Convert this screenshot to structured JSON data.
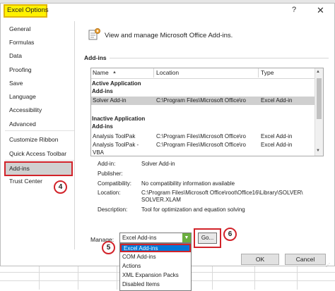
{
  "window": {
    "title": "Excel Options",
    "help_glyph": "?",
    "close_glyph": "✕"
  },
  "sidebar": {
    "items": [
      {
        "label": "General"
      },
      {
        "label": "Formulas"
      },
      {
        "label": "Data"
      },
      {
        "label": "Proofing"
      },
      {
        "label": "Save"
      },
      {
        "label": "Language"
      },
      {
        "label": "Accessibility"
      },
      {
        "label": "Advanced"
      },
      {
        "label": "Customize Ribbon"
      },
      {
        "label": "Quick Access Toolbar"
      },
      {
        "label": "Add-ins",
        "selected": true
      },
      {
        "label": "Trust Center"
      }
    ],
    "step_badge": "4"
  },
  "main": {
    "header_text": "View and manage Microsoft Office Add-ins.",
    "section_title": "Add-ins",
    "table": {
      "columns": [
        "Name",
        "Location",
        "Type"
      ],
      "sort_indicator": "▲",
      "groups": [
        {
          "title_lines": [
            "Active Application",
            "Add-ins"
          ],
          "rows": [
            {
              "name": "Solver Add-in",
              "location": "C:\\Program Files\\Microsoft Office\\ro",
              "type": "Excel Add-in",
              "selected": true
            }
          ]
        },
        {
          "title_lines": [
            "Inactive Application",
            "Add-ins"
          ],
          "rows": [
            {
              "name": "Analysis ToolPak",
              "location": "C:\\Program Files\\Microsoft Office\\ro",
              "type": "Excel Add-in"
            },
            {
              "name": "Analysis ToolPak -",
              "location": "C:\\Program Files\\Microsoft Office\\ro",
              "type": "Excel Add-in"
            },
            {
              "name": "VBA",
              "location": "",
              "type": ""
            }
          ]
        }
      ]
    },
    "details": {
      "addin_label": "Add-in:",
      "addin_value": "Solver Add-in",
      "publisher_label": "Publisher:",
      "publisher_value": "",
      "compat_label": "Compatibility:",
      "compat_value": "No compatibility information available",
      "location_label": "Location:",
      "location_value_1": "C:\\Program Files\\Microsoft Office\\root\\Office16\\Library\\SOLVER\\",
      "location_value_2": "SOLVER.XLAM",
      "description_label": "Description:",
      "description_value": "Tool for optimization and equation solving"
    },
    "manage": {
      "label": "Manage:",
      "selected_value": "Excel Add-ins",
      "options": [
        "Excel Add-ins",
        "COM Add-ins",
        "Actions",
        "XML Expansion Packs",
        "Disabled Items"
      ],
      "go_label": "Go...",
      "step_badge_select": "5",
      "step_badge_go": "6"
    },
    "ok_label": "OK",
    "cancel_label": "Cancel"
  },
  "colors": {
    "highlight_red": "#d2232a",
    "title_highlight": "#fff200",
    "selection_blue": "#0078d7",
    "dropdown_green": "#6bae3f"
  },
  "icons": {
    "header": "addins-gear-icon",
    "help": "help-icon",
    "close": "close-icon",
    "dropdown": "chevron-down-icon"
  }
}
